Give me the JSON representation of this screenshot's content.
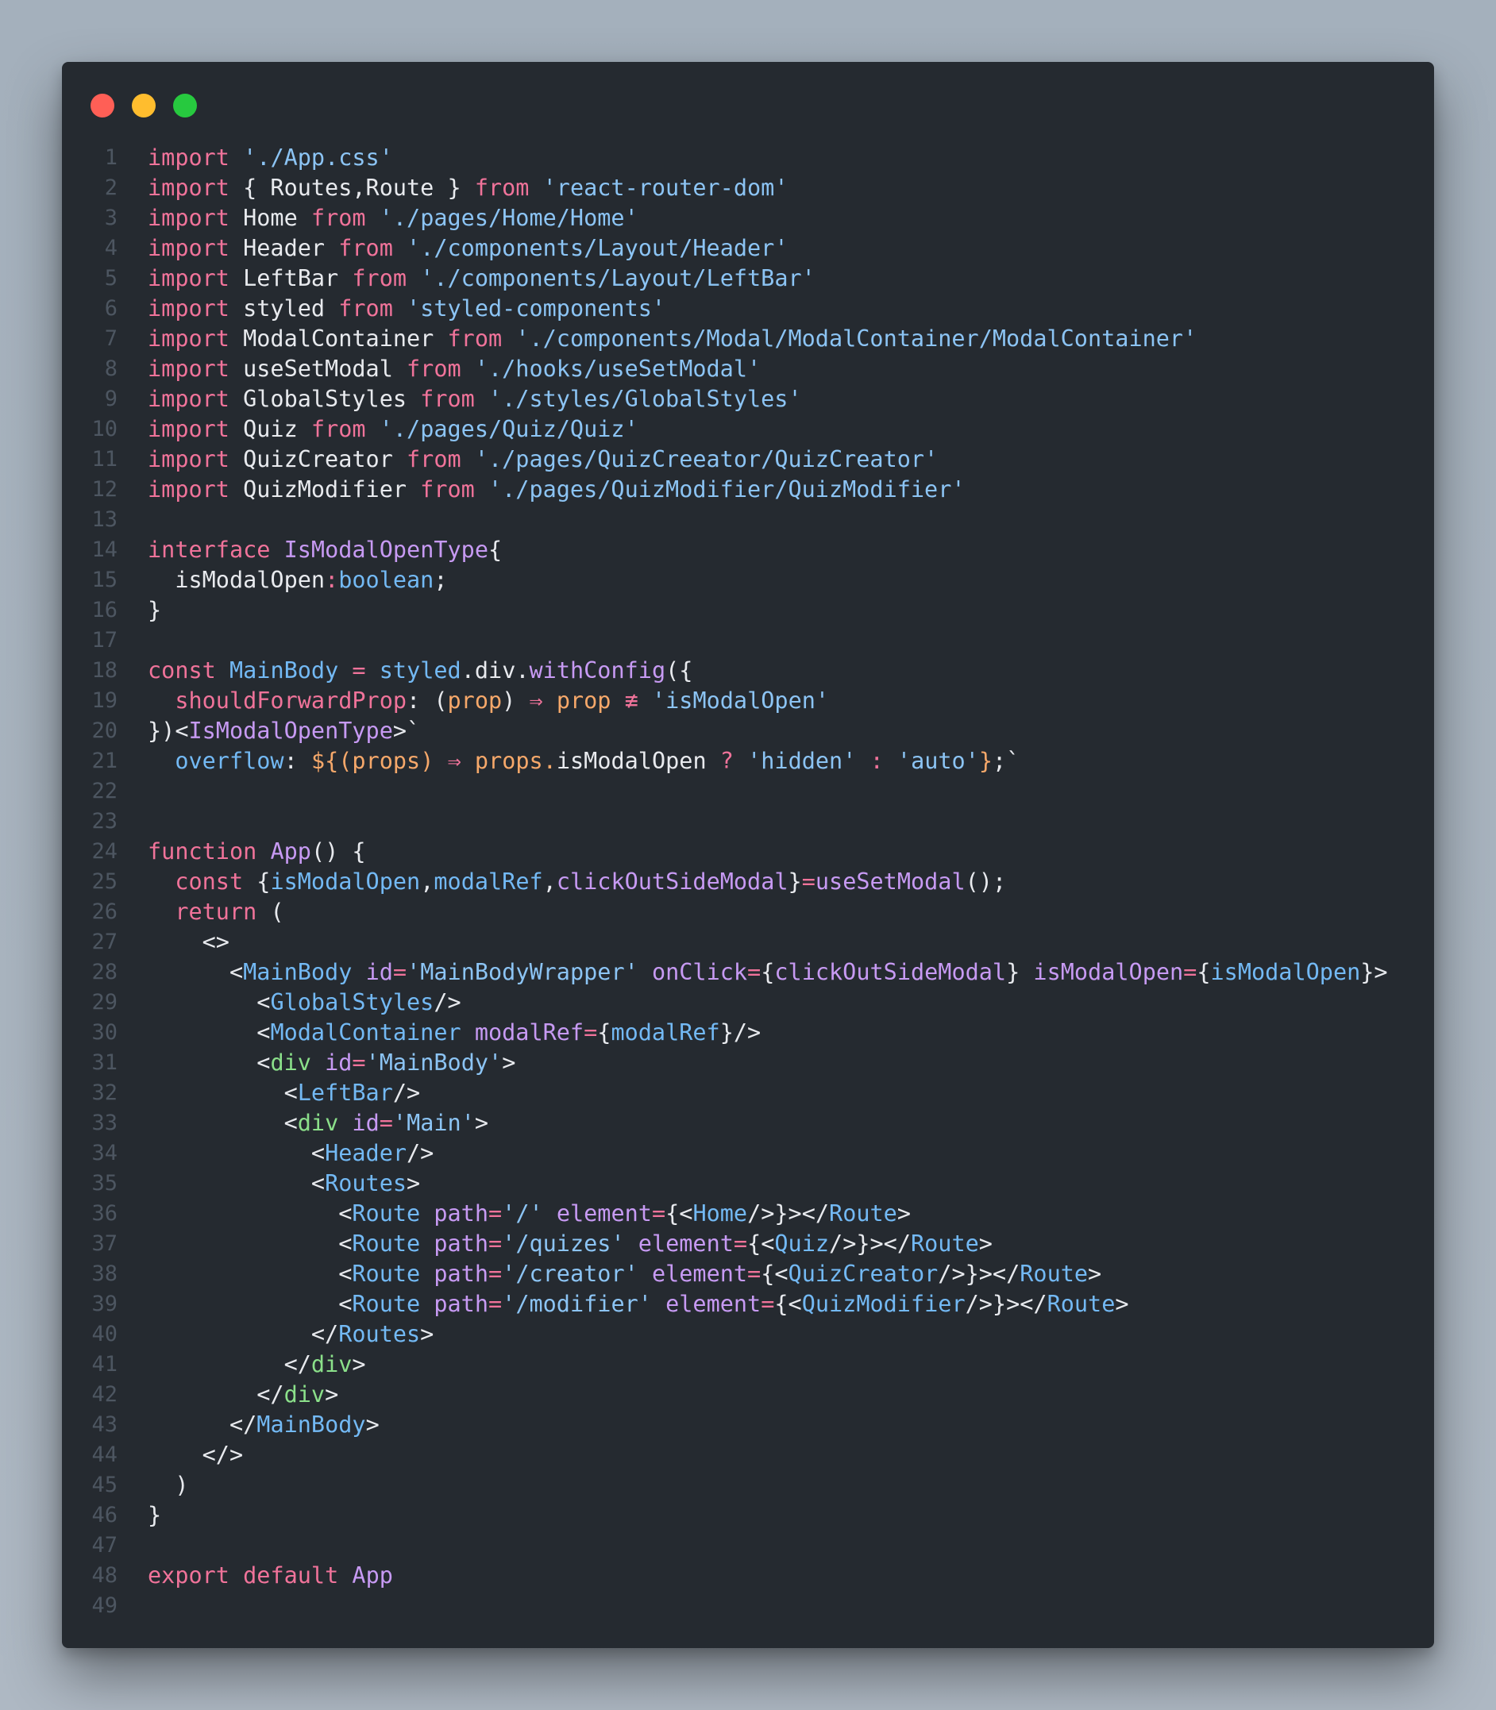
{
  "window": {
    "traffic_lights": [
      {
        "name": "close",
        "color": "#ff5f56"
      },
      {
        "name": "minimize",
        "color": "#ffbd2e"
      },
      {
        "name": "zoom",
        "color": "#27c93f"
      }
    ]
  },
  "code_lines": [
    [
      [
        "kw",
        "import"
      ],
      [
        "pl",
        " "
      ],
      [
        "str",
        "'./App.css'"
      ]
    ],
    [
      [
        "kw",
        "import"
      ],
      [
        "pl",
        " { Routes,Route } "
      ],
      [
        "kw",
        "from"
      ],
      [
        "pl",
        " "
      ],
      [
        "str",
        "'react-router-dom'"
      ]
    ],
    [
      [
        "kw",
        "import"
      ],
      [
        "pl",
        " Home "
      ],
      [
        "kw",
        "from"
      ],
      [
        "pl",
        " "
      ],
      [
        "str",
        "'./pages/Home/Home'"
      ]
    ],
    [
      [
        "kw",
        "import"
      ],
      [
        "pl",
        " Header "
      ],
      [
        "kw",
        "from"
      ],
      [
        "pl",
        " "
      ],
      [
        "str",
        "'./components/Layout/Header'"
      ]
    ],
    [
      [
        "kw",
        "import"
      ],
      [
        "pl",
        " LeftBar "
      ],
      [
        "kw",
        "from"
      ],
      [
        "pl",
        " "
      ],
      [
        "str",
        "'./components/Layout/LeftBar'"
      ]
    ],
    [
      [
        "kw",
        "import"
      ],
      [
        "pl",
        " styled "
      ],
      [
        "kw",
        "from"
      ],
      [
        "pl",
        " "
      ],
      [
        "str",
        "'styled-components'"
      ]
    ],
    [
      [
        "kw",
        "import"
      ],
      [
        "pl",
        " ModalContainer "
      ],
      [
        "kw",
        "from"
      ],
      [
        "pl",
        " "
      ],
      [
        "str",
        "'./components/Modal/ModalContainer/ModalContainer'"
      ]
    ],
    [
      [
        "kw",
        "import"
      ],
      [
        "pl",
        " useSetModal "
      ],
      [
        "kw",
        "from"
      ],
      [
        "pl",
        " "
      ],
      [
        "str",
        "'./hooks/useSetModal'"
      ]
    ],
    [
      [
        "kw",
        "import"
      ],
      [
        "pl",
        " GlobalStyles "
      ],
      [
        "kw",
        "from"
      ],
      [
        "pl",
        " "
      ],
      [
        "str",
        "'./styles/GlobalStyles'"
      ]
    ],
    [
      [
        "kw",
        "import"
      ],
      [
        "pl",
        " Quiz "
      ],
      [
        "kw",
        "from"
      ],
      [
        "pl",
        " "
      ],
      [
        "str",
        "'./pages/Quiz/Quiz'"
      ]
    ],
    [
      [
        "kw",
        "import"
      ],
      [
        "pl",
        " QuizCreator "
      ],
      [
        "kw",
        "from"
      ],
      [
        "pl",
        " "
      ],
      [
        "str",
        "'./pages/QuizCreeator/QuizCreator'"
      ]
    ],
    [
      [
        "kw",
        "import"
      ],
      [
        "pl",
        " QuizModifier "
      ],
      [
        "kw",
        "from"
      ],
      [
        "pl",
        " "
      ],
      [
        "str",
        "'./pages/QuizModifier/QuizModifier'"
      ]
    ],
    [],
    [
      [
        "kw",
        "interface"
      ],
      [
        "pl",
        " "
      ],
      [
        "ty",
        "IsModalOpenType"
      ],
      [
        "pl",
        "{"
      ]
    ],
    [
      [
        "pl",
        "  isModalOpen"
      ],
      [
        "kw",
        ":"
      ],
      [
        "blue",
        "boolean"
      ],
      [
        "pl",
        ";"
      ]
    ],
    [
      [
        "pl",
        "}"
      ]
    ],
    [],
    [
      [
        "kw",
        "const"
      ],
      [
        "pl",
        " "
      ],
      [
        "blue",
        "MainBody"
      ],
      [
        "pl",
        " "
      ],
      [
        "kw",
        "="
      ],
      [
        "pl",
        " "
      ],
      [
        "blue",
        "styled"
      ],
      [
        "pl",
        ".div."
      ],
      [
        "fn",
        "withConfig"
      ],
      [
        "pl",
        "({"
      ]
    ],
    [
      [
        "pl",
        "  "
      ],
      [
        "kw",
        "shouldForwardProp"
      ],
      [
        "pl",
        ": ("
      ],
      [
        "orange",
        "prop"
      ],
      [
        "pl",
        ") "
      ],
      [
        "kw",
        "⇒"
      ],
      [
        "pl",
        " "
      ],
      [
        "orange",
        "prop"
      ],
      [
        "pl",
        " "
      ],
      [
        "kw",
        "≢"
      ],
      [
        "pl",
        " "
      ],
      [
        "str",
        "'isModalOpen'"
      ]
    ],
    [
      [
        "pl",
        "})<"
      ],
      [
        "ty",
        "IsModalOpenType"
      ],
      [
        "pl",
        ">`"
      ]
    ],
    [
      [
        "pl",
        "  "
      ],
      [
        "blue",
        "overflow"
      ],
      [
        "pl",
        ": "
      ],
      [
        "orange",
        "${("
      ],
      [
        "orange",
        "props"
      ],
      [
        "orange",
        ")"
      ],
      [
        "pl",
        " "
      ],
      [
        "kw",
        "⇒"
      ],
      [
        "pl",
        " "
      ],
      [
        "orange",
        "props."
      ],
      [
        "pl",
        "isModalOpen "
      ],
      [
        "kw",
        "?"
      ],
      [
        "pl",
        " "
      ],
      [
        "str",
        "'hidden'"
      ],
      [
        "pl",
        " "
      ],
      [
        "kw",
        ":"
      ],
      [
        "pl",
        " "
      ],
      [
        "str",
        "'auto'"
      ],
      [
        "orange",
        "}"
      ],
      [
        "pl",
        ";`"
      ]
    ],
    [],
    [],
    [
      [
        "kw",
        "function"
      ],
      [
        "pl",
        " "
      ],
      [
        "fn",
        "App"
      ],
      [
        "pl",
        "() {"
      ]
    ],
    [
      [
        "pl",
        "  "
      ],
      [
        "kw",
        "const"
      ],
      [
        "pl",
        " {"
      ],
      [
        "blue",
        "isModalOpen"
      ],
      [
        "pl",
        ","
      ],
      [
        "blue",
        "modalRef"
      ],
      [
        "pl",
        ","
      ],
      [
        "fn",
        "clickOutSideModal"
      ],
      [
        "pl",
        "}"
      ],
      [
        "kw",
        "="
      ],
      [
        "fn",
        "useSetModal"
      ],
      [
        "pl",
        "();"
      ]
    ],
    [
      [
        "pl",
        "  "
      ],
      [
        "kw",
        "return"
      ],
      [
        "pl",
        " ("
      ]
    ],
    [
      [
        "pl",
        "    <>"
      ]
    ],
    [
      [
        "pl",
        "      <"
      ],
      [
        "blue",
        "MainBody"
      ],
      [
        "pl",
        " "
      ],
      [
        "ty",
        "id"
      ],
      [
        "kw",
        "="
      ],
      [
        "str",
        "'MainBodyWrapper'"
      ],
      [
        "pl",
        " "
      ],
      [
        "ty",
        "onClick"
      ],
      [
        "kw",
        "="
      ],
      [
        "pl",
        "{"
      ],
      [
        "fn",
        "clickOutSideModal"
      ],
      [
        "pl",
        "} "
      ],
      [
        "ty",
        "isModalOpen"
      ],
      [
        "kw",
        "="
      ],
      [
        "pl",
        "{"
      ],
      [
        "blue",
        "isModalOpen"
      ],
      [
        "pl",
        "}>"
      ]
    ],
    [
      [
        "pl",
        "        <"
      ],
      [
        "blue",
        "GlobalStyles"
      ],
      [
        "pl",
        "/>"
      ]
    ],
    [
      [
        "pl",
        "        <"
      ],
      [
        "blue",
        "ModalContainer"
      ],
      [
        "pl",
        " "
      ],
      [
        "ty",
        "modalRef"
      ],
      [
        "kw",
        "="
      ],
      [
        "pl",
        "{"
      ],
      [
        "blue",
        "modalRef"
      ],
      [
        "pl",
        "}/>"
      ]
    ],
    [
      [
        "pl",
        "        <"
      ],
      [
        "green",
        "div"
      ],
      [
        "pl",
        " "
      ],
      [
        "ty",
        "id"
      ],
      [
        "kw",
        "="
      ],
      [
        "str",
        "'MainBody'"
      ],
      [
        "pl",
        ">"
      ]
    ],
    [
      [
        "pl",
        "          <"
      ],
      [
        "blue",
        "LeftBar"
      ],
      [
        "pl",
        "/>"
      ]
    ],
    [
      [
        "pl",
        "          <"
      ],
      [
        "green",
        "div"
      ],
      [
        "pl",
        " "
      ],
      [
        "ty",
        "id"
      ],
      [
        "kw",
        "="
      ],
      [
        "str",
        "'Main'"
      ],
      [
        "pl",
        ">"
      ]
    ],
    [
      [
        "pl",
        "            <"
      ],
      [
        "blue",
        "Header"
      ],
      [
        "pl",
        "/>"
      ]
    ],
    [
      [
        "pl",
        "            <"
      ],
      [
        "blue",
        "Routes"
      ],
      [
        "pl",
        ">"
      ]
    ],
    [
      [
        "pl",
        "              <"
      ],
      [
        "blue",
        "Route"
      ],
      [
        "pl",
        " "
      ],
      [
        "ty",
        "path"
      ],
      [
        "kw",
        "="
      ],
      [
        "str",
        "'/'"
      ],
      [
        "pl",
        " "
      ],
      [
        "ty",
        "element"
      ],
      [
        "kw",
        "="
      ],
      [
        "pl",
        "{<"
      ],
      [
        "blue",
        "Home"
      ],
      [
        "pl",
        "/>}></"
      ],
      [
        "blue",
        "Route"
      ],
      [
        "pl",
        ">"
      ]
    ],
    [
      [
        "pl",
        "              <"
      ],
      [
        "blue",
        "Route"
      ],
      [
        "pl",
        " "
      ],
      [
        "ty",
        "path"
      ],
      [
        "kw",
        "="
      ],
      [
        "str",
        "'/quizes'"
      ],
      [
        "pl",
        " "
      ],
      [
        "ty",
        "element"
      ],
      [
        "kw",
        "="
      ],
      [
        "pl",
        "{<"
      ],
      [
        "blue",
        "Quiz"
      ],
      [
        "pl",
        "/>}></"
      ],
      [
        "blue",
        "Route"
      ],
      [
        "pl",
        ">"
      ]
    ],
    [
      [
        "pl",
        "              <"
      ],
      [
        "blue",
        "Route"
      ],
      [
        "pl",
        " "
      ],
      [
        "ty",
        "path"
      ],
      [
        "kw",
        "="
      ],
      [
        "str",
        "'/creator'"
      ],
      [
        "pl",
        " "
      ],
      [
        "ty",
        "element"
      ],
      [
        "kw",
        "="
      ],
      [
        "pl",
        "{<"
      ],
      [
        "blue",
        "QuizCreator"
      ],
      [
        "pl",
        "/>}></"
      ],
      [
        "blue",
        "Route"
      ],
      [
        "pl",
        ">"
      ]
    ],
    [
      [
        "pl",
        "              <"
      ],
      [
        "blue",
        "Route"
      ],
      [
        "pl",
        " "
      ],
      [
        "ty",
        "path"
      ],
      [
        "kw",
        "="
      ],
      [
        "str",
        "'/modifier'"
      ],
      [
        "pl",
        " "
      ],
      [
        "ty",
        "element"
      ],
      [
        "kw",
        "="
      ],
      [
        "pl",
        "{<"
      ],
      [
        "blue",
        "QuizModifier"
      ],
      [
        "pl",
        "/>}></"
      ],
      [
        "blue",
        "Route"
      ],
      [
        "pl",
        ">"
      ]
    ],
    [
      [
        "pl",
        "            </"
      ],
      [
        "blue",
        "Routes"
      ],
      [
        "pl",
        ">"
      ]
    ],
    [
      [
        "pl",
        "          </"
      ],
      [
        "green",
        "div"
      ],
      [
        "pl",
        ">"
      ]
    ],
    [
      [
        "pl",
        "        </"
      ],
      [
        "green",
        "div"
      ],
      [
        "pl",
        ">"
      ]
    ],
    [
      [
        "pl",
        "      </"
      ],
      [
        "blue",
        "MainBody"
      ],
      [
        "pl",
        ">"
      ]
    ],
    [
      [
        "pl",
        "    </>"
      ]
    ],
    [
      [
        "pl",
        "  )"
      ]
    ],
    [
      [
        "pl",
        "}"
      ]
    ],
    [],
    [
      [
        "kw",
        "export"
      ],
      [
        "pl",
        " "
      ],
      [
        "kw",
        "default"
      ],
      [
        "pl",
        " "
      ],
      [
        "fn",
        "App"
      ]
    ],
    []
  ]
}
